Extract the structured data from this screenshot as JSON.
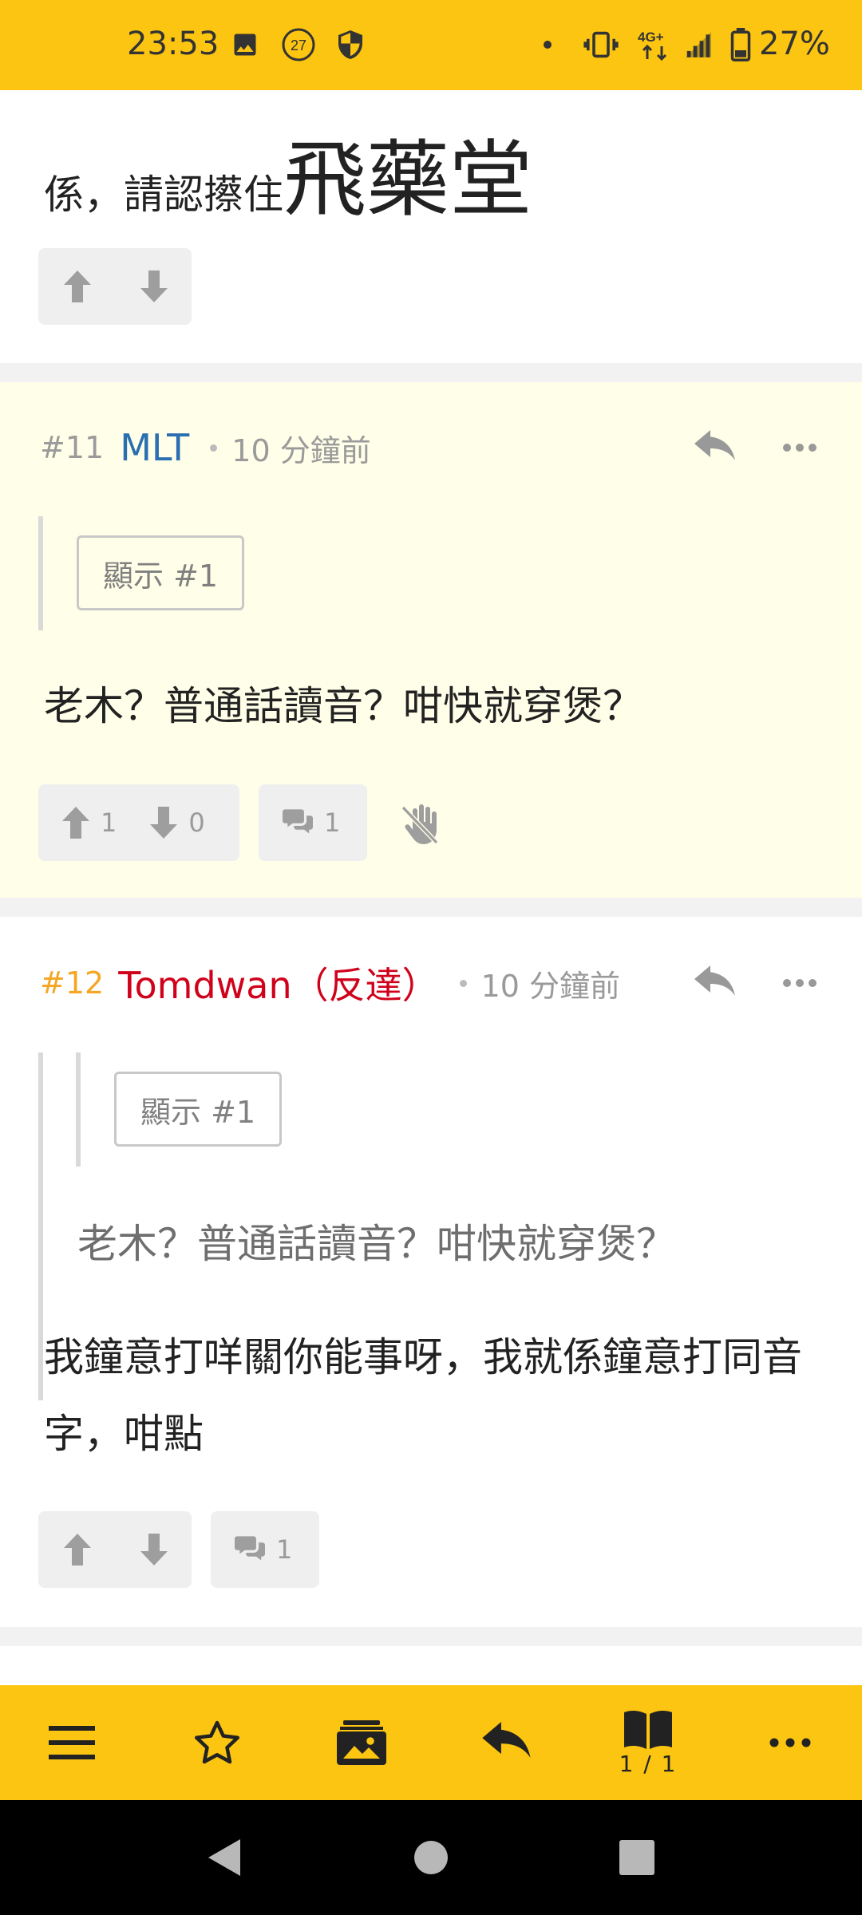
{
  "status_bar": {
    "time": "23:53",
    "notification_badge": "27",
    "network": "4G+",
    "battery": "27%"
  },
  "posts": [
    {
      "text_small": "係，請認攃住",
      "text_big": "飛藥堂"
    },
    {
      "number": "#11",
      "author": "MLT",
      "author_color": "#2a6fb0",
      "time": "10 分鐘前",
      "show_button": "顯示 #1",
      "body": "老木？普通話讀音？咁快就穿煲？",
      "upvotes": "1",
      "downvotes": "0",
      "replies": "1",
      "background": "#fffee8"
    },
    {
      "number": "#12",
      "author": "Tomdwan（反達）",
      "author_color": "#d0021b",
      "number_color": "#f5a623",
      "time": "10 分鐘前",
      "show_button": "顯示 #1",
      "quote": "老木？普通話讀音？咁快就穿煲？",
      "body": "我鐘意打咩關你能事呀，我就係鐘意打同音字，咁點",
      "replies": "1"
    }
  ],
  "bottom_bar": {
    "page_indicator": "1 / 1"
  },
  "icons": {
    "menu": "hamburger-icon",
    "favorite": "star-icon",
    "images": "image-gallery-icon",
    "reply": "reply-icon",
    "pages": "book-icon",
    "more": "more-icon"
  }
}
